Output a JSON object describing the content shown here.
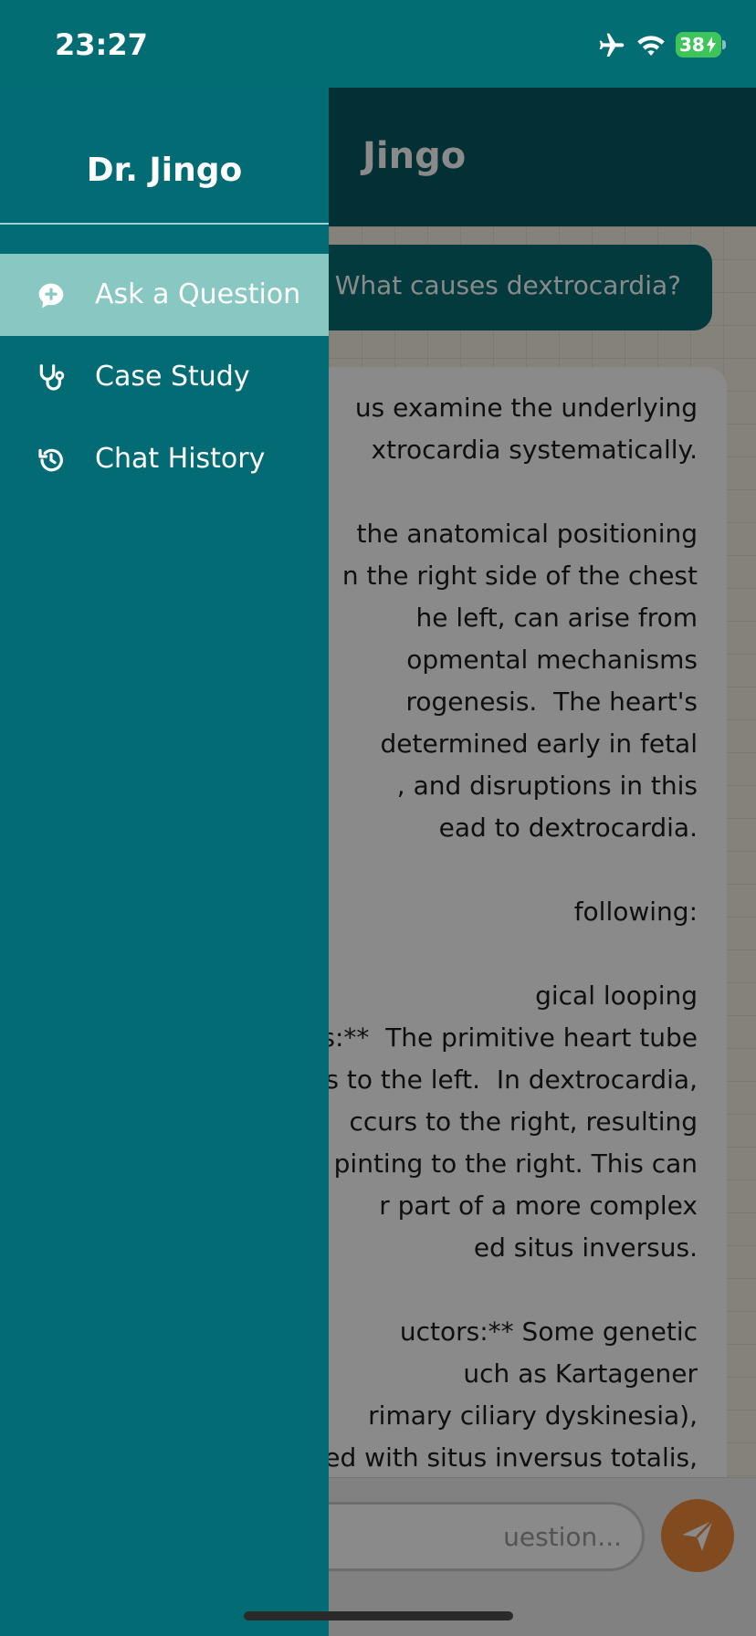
{
  "status_bar": {
    "time": "23:27",
    "battery_level": "38",
    "icons": [
      "airplane-icon",
      "wifi-icon",
      "battery-charging-icon"
    ]
  },
  "header": {
    "title": "Jingo"
  },
  "chat": {
    "user_message": "What causes dextrocardia?",
    "bot_message_lines": [
      "us examine the underlying",
      "xtrocardia systematically.",
      "",
      "the anatomical positioning",
      "n the right side of the chest",
      "he left, can arise from",
      "opmental mechanisms",
      "rogenesis.  The heart's",
      "determined early in fetal",
      ", and disruptions in this",
      "ead to dextrocardia.",
      "",
      "following:",
      "",
      "gical looping",
      "s:**  The primitive heart tube",
      "s to the left.  In dextrocardia,",
      "ccurs to the right, resulting",
      "pinting to the right. This can",
      "r part of a more complex",
      "ed situs inversus.",
      "",
      "uctors:** Some genetic",
      "uch as Kartagener",
      "rimary ciliary dyskinesia),",
      "ed with situs inversus totalis,"
    ]
  },
  "composer": {
    "placeholder": "uestion..."
  },
  "drawer": {
    "title": "Dr. Jingo",
    "items": [
      {
        "label": "Ask a Question",
        "icon": "chat-plus-icon",
        "active": true
      },
      {
        "label": "Case Study",
        "icon": "stethoscope-icon",
        "active": false
      },
      {
        "label": "Chat History",
        "icon": "history-icon",
        "active": false
      }
    ]
  },
  "colors": {
    "primary": "#036b73",
    "header_dark": "#045a61",
    "active_item": "#89c8c2",
    "send_button": "#f08a3a",
    "battery": "#3ec55a"
  }
}
